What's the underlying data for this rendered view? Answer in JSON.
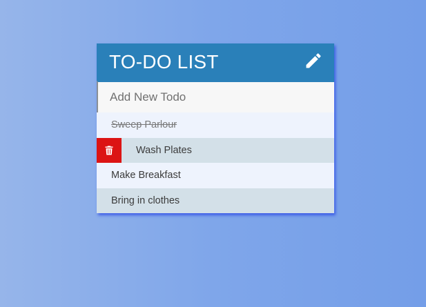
{
  "header": {
    "title": "TO-DO LIST"
  },
  "input": {
    "placeholder": "Add New Todo"
  },
  "todos": [
    {
      "text": "Sweep Parlour",
      "completed": true
    },
    {
      "text": "Wash Plates",
      "completed": false
    },
    {
      "text": "Make Breakfast",
      "completed": false
    },
    {
      "text": "Bring in clothes",
      "completed": false
    }
  ],
  "icons": {
    "edit": "pencil-icon",
    "delete": "trash-icon"
  },
  "colors": {
    "header": "#2a80b9",
    "delete": "#dc1414",
    "row_odd": "#eef3fd",
    "row_even": "#d3e0e8"
  }
}
